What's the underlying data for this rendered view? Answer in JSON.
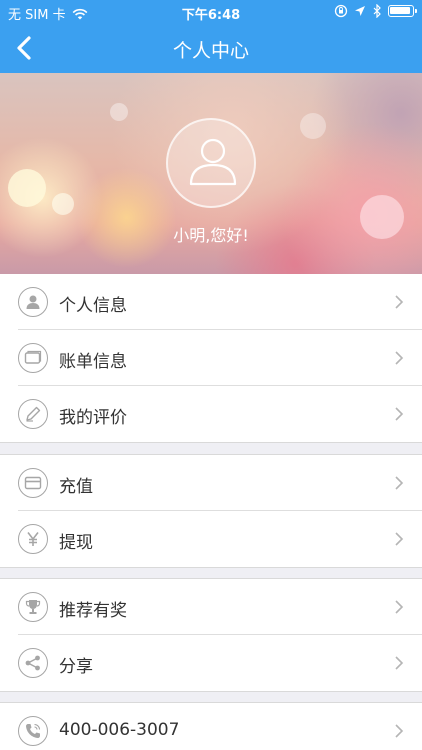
{
  "status_bar": {
    "carrier": "无 SIM 卡",
    "time": "下午6:48"
  },
  "nav": {
    "title": "个人中心"
  },
  "profile": {
    "greeting": "小明,您好!"
  },
  "groups": [
    {
      "items": [
        {
          "label": "个人信息",
          "icon": "person-icon"
        },
        {
          "label": "账单信息",
          "icon": "bill-icon"
        },
        {
          "label": "我的评价",
          "icon": "pen-icon"
        }
      ]
    },
    {
      "items": [
        {
          "label": "充值",
          "icon": "card-icon"
        },
        {
          "label": "提现",
          "icon": "yen-icon"
        }
      ]
    },
    {
      "items": [
        {
          "label": "推荐有奖",
          "icon": "trophy-icon"
        },
        {
          "label": "分享",
          "icon": "share-icon"
        }
      ]
    },
    {
      "items": [
        {
          "label": "400-006-3007",
          "icon": "phone-icon"
        }
      ]
    }
  ],
  "colors": {
    "nav_background": "#3ba0f0",
    "page_background": "#efeff4",
    "icon_gray": "#a6a6a6"
  }
}
